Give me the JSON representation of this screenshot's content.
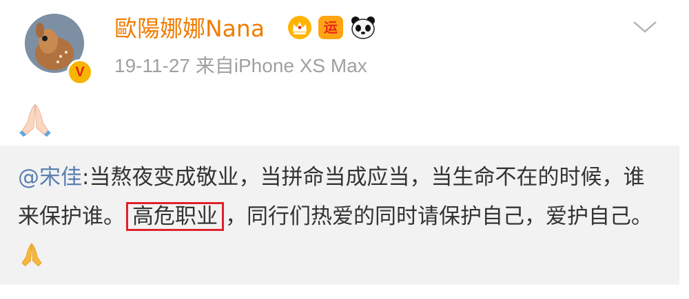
{
  "post": {
    "username": "歐陽娜娜Nana",
    "meta": "19-11-27  来自iPhone XS Max",
    "verified_badge": "V",
    "badges": {
      "crown": "crown-icon",
      "yun_label": "运",
      "panda": "panda-icon"
    },
    "body_emoji": "praying-hands-icon"
  },
  "repost": {
    "mention": "@宋佳",
    "colon": ":",
    "text_before": "当熬夜变成敬业，当拼命当成应当，当生命不在的时候，谁来保护谁。",
    "highlight": "高危职业",
    "text_after": "，同行们热爱的同时请保护自己，爱护自己。"
  },
  "colors": {
    "username": "#f07c00",
    "mention": "#5b7fb0",
    "highlight_border": "#e0202a",
    "meta": "#a0a0a0"
  }
}
